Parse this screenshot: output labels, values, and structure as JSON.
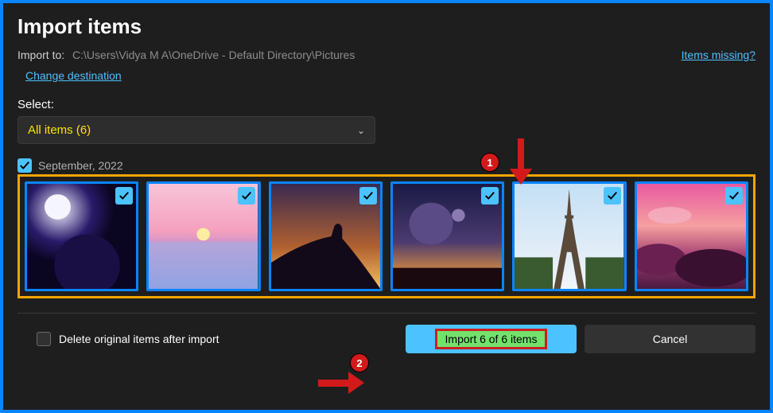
{
  "title": "Import items",
  "import_to_label": "Import to:",
  "import_to_path": "C:\\Users\\Vidya M A\\OneDrive - Default Directory\\Pictures",
  "change_destination": "Change destination",
  "items_missing": "Items missing?",
  "select_label": "Select:",
  "select_value": "All items (6)",
  "date_group": {
    "label": "September, 2022",
    "checked": true
  },
  "thumbnails": [
    {
      "checked": true
    },
    {
      "checked": true
    },
    {
      "checked": true
    },
    {
      "checked": true
    },
    {
      "checked": true
    },
    {
      "checked": true
    }
  ],
  "delete_option": {
    "label": "Delete original items after import",
    "checked": false
  },
  "primary_button": "Import 6 of 6 items",
  "secondary_button": "Cancel",
  "annotations": {
    "badge1": "1",
    "badge2": "2"
  }
}
